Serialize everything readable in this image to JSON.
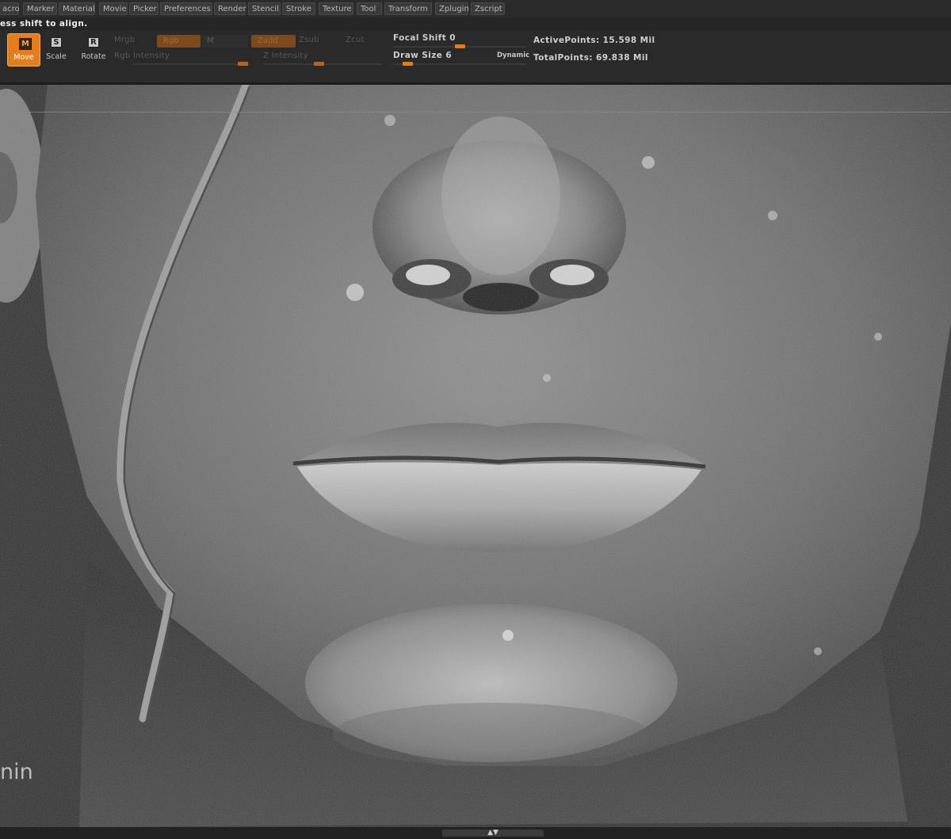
{
  "menu": {
    "items": [
      "acro",
      "Marker",
      "Material",
      "Movie",
      "Picker",
      "Preferences",
      "Render",
      "Stencil",
      "Stroke",
      "Texture",
      "Tool",
      "Transform",
      "Zplugin",
      "Zscript"
    ]
  },
  "hint_text": "ess shift to align.",
  "toolbar": {
    "move": {
      "icon": "M",
      "label": "Move"
    },
    "scale": {
      "icon": "S",
      "label": "Scale"
    },
    "rotate": {
      "icon": "R",
      "label": "Rotate"
    },
    "mrgb": "Mrgb",
    "rgb": "Rgb",
    "m": "M",
    "zadd": "Zadd",
    "zsub": "Zsub",
    "zcut": "Zcut",
    "rgb_intensity": "Rgb Intensity",
    "z_intensity": "Z Intensity",
    "focal_shift": "Focal Shift 0",
    "draw_size": "Draw Size 6",
    "dynamic": "Dynamic",
    "active_points": "ActivePoints: 15.598 Mil",
    "total_points": "TotalPoints: 69.838 Mil"
  },
  "viewport": {
    "corner_text": "nin"
  },
  "bottom_bar": {
    "handle_glyph": "▲▼"
  },
  "colors": {
    "accent": "#e37d1d",
    "background": "#262626",
    "toolbar": "#2a2a2a"
  }
}
